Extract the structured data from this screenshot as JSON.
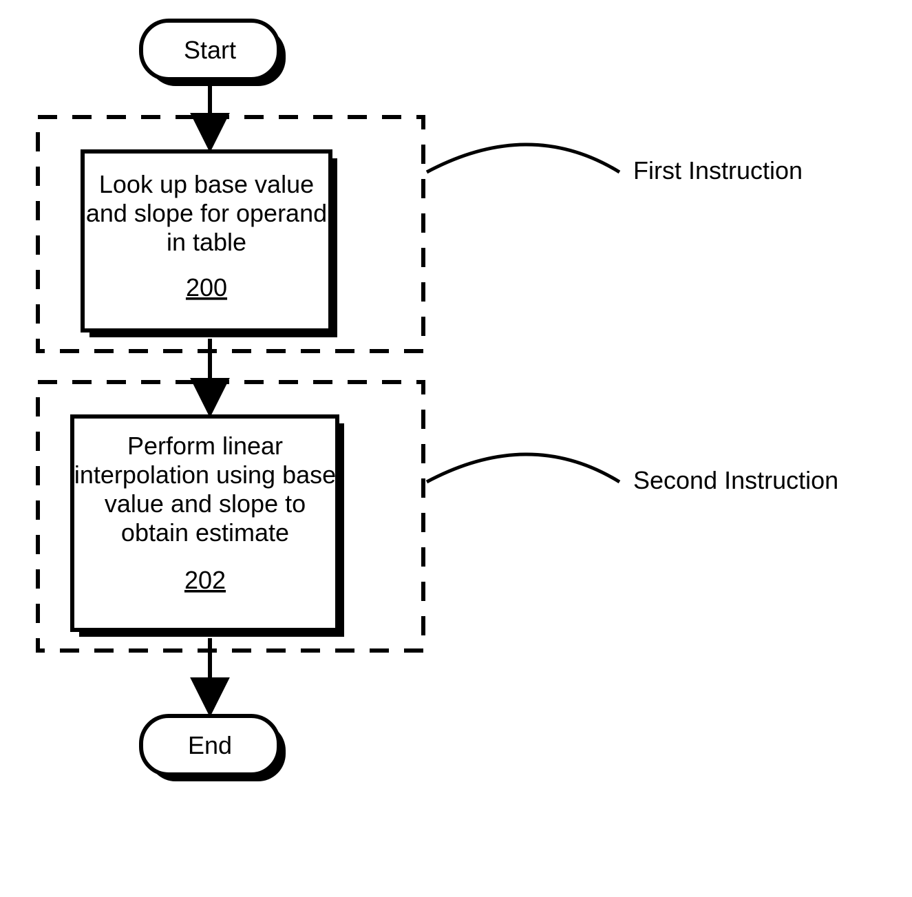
{
  "flowchart": {
    "start": "Start",
    "end": "End",
    "step1": {
      "line1": "Look up base value",
      "line2": "and slope for operand",
      "line3": "in table",
      "ref": "200"
    },
    "step2": {
      "line1": "Perform linear",
      "line2": "interpolation using base",
      "line3": "value and slope to",
      "line4": "obtain estimate",
      "ref": "202"
    },
    "label1": "First Instruction",
    "label2": "Second Instruction"
  }
}
